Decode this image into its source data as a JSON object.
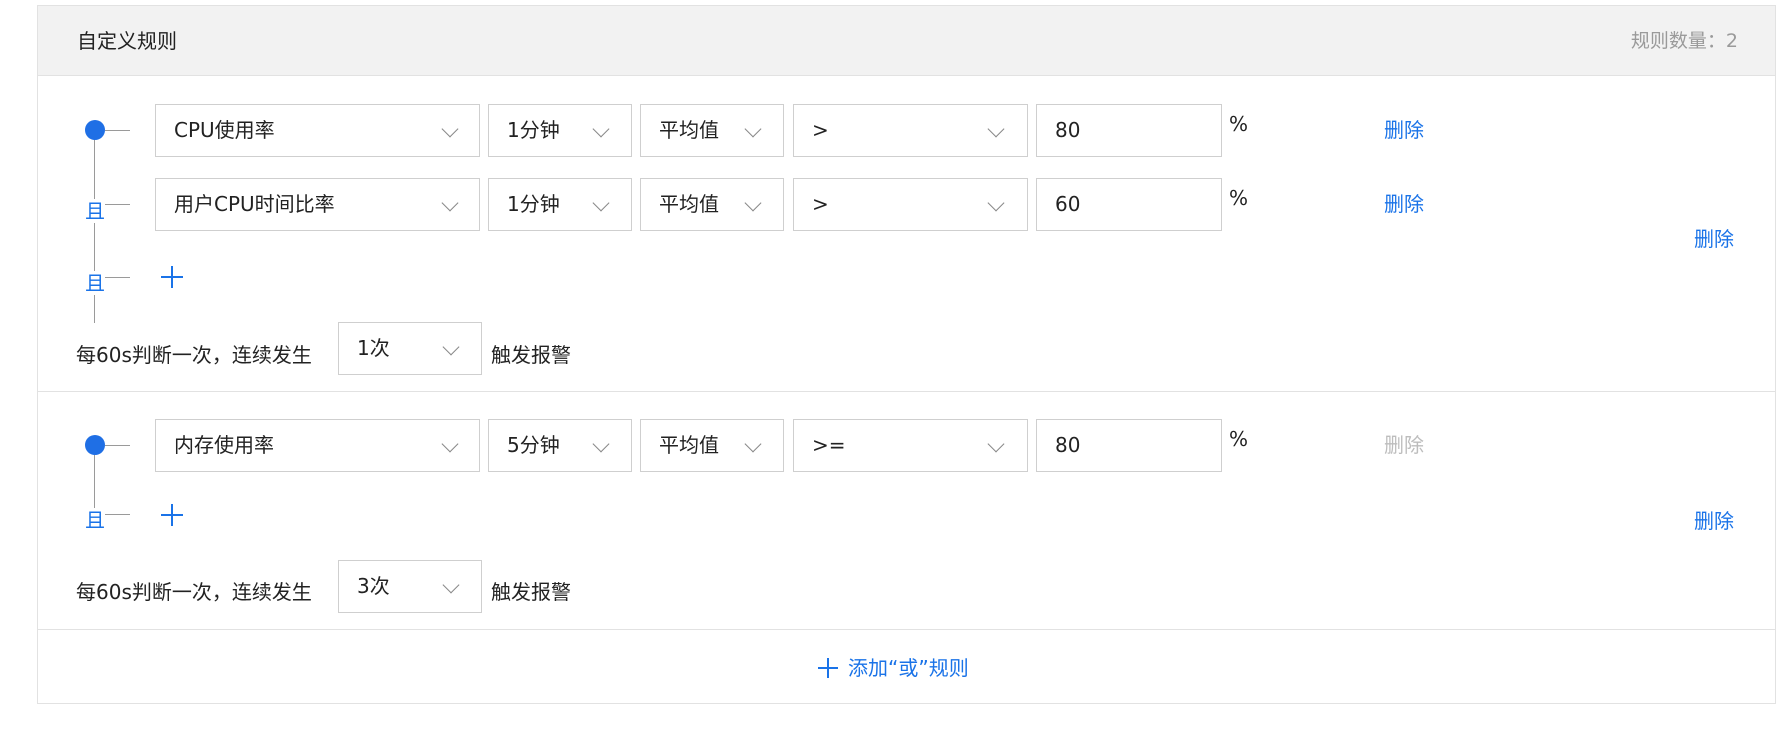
{
  "header": {
    "title": "自定义规则",
    "count_label": "规则数量：2"
  },
  "groups": [
    {
      "rules": [
        {
          "metric": "CPU使用率",
          "period": "1分钟",
          "stat": "平均值",
          "operator": ">",
          "threshold": "80",
          "unit": "%",
          "delete_label": "删除",
          "delete_enabled": true
        },
        {
          "metric": "用户CPU时间比率",
          "period": "1分钟",
          "stat": "平均值",
          "operator": ">",
          "threshold": "60",
          "unit": "%",
          "delete_label": "删除",
          "delete_enabled": true
        }
      ],
      "and_label": "且",
      "freq_prefix": "每60s判断一次，连续发生",
      "times": "1次",
      "freq_suffix": "触发报警",
      "group_delete_label": "删除"
    },
    {
      "rules": [
        {
          "metric": "内存使用率",
          "period": "5分钟",
          "stat": "平均值",
          "operator": ">=",
          "threshold": "80",
          "unit": "%",
          "delete_label": "删除",
          "delete_enabled": false
        }
      ],
      "and_label": "且",
      "freq_prefix": "每60s判断一次，连续发生",
      "times": "3次",
      "freq_suffix": "触发报警",
      "group_delete_label": "删除"
    }
  ],
  "footer": {
    "add_or_label": "添加“或”规则"
  },
  "icons": {
    "add": "plus-icon",
    "dropdown": "chevron-down-icon",
    "connector": "dot-icon"
  },
  "colors": {
    "accent": "#1a73e8",
    "node": "#1f6fe5",
    "disabled": "#bdbdbd",
    "header_bg": "#f2f2f2"
  }
}
